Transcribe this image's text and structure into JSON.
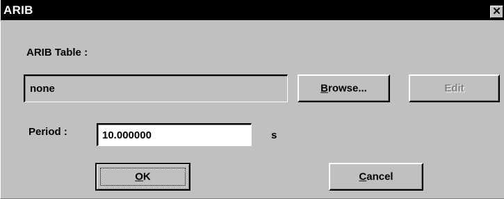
{
  "window": {
    "title": "ARIB",
    "close_glyph": "✕"
  },
  "arib_table": {
    "label": "ARIB Table :",
    "value": "none"
  },
  "buttons": {
    "browse_hotkey": "B",
    "browse_rest": "rowse...",
    "edit": "Edit",
    "ok_hotkey": "O",
    "ok_rest": "K",
    "cancel_hotkey": "C",
    "cancel_rest": "ancel"
  },
  "period": {
    "label": "Period :",
    "value": "10.000000",
    "unit": "s"
  },
  "colors": {
    "face": "#c0c0c0",
    "titlebar": "#000000",
    "disabled_text": "#808080"
  }
}
